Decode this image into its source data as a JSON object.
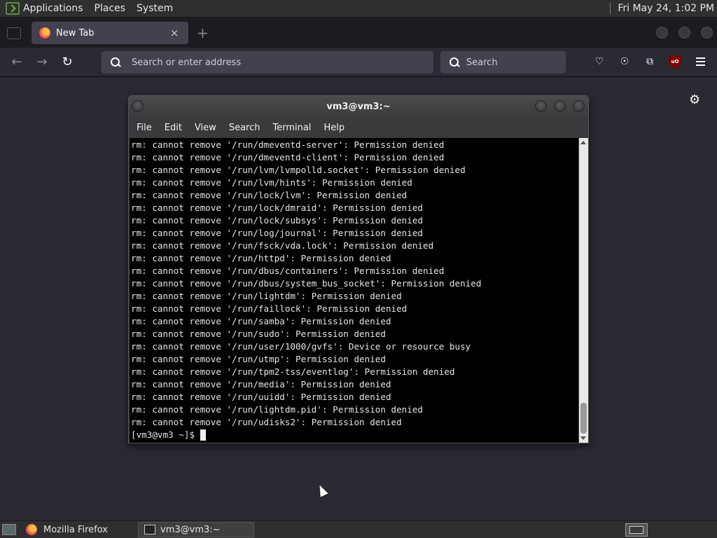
{
  "top_panel": {
    "menus": [
      "Applications",
      "Places",
      "System"
    ],
    "clock": "Fri May 24,  1:02 PM"
  },
  "firefox": {
    "tab": {
      "title": "New Tab",
      "close": "×"
    },
    "urlbar": {
      "placeholder": "Search or enter address"
    },
    "searchbar": {
      "placeholder": "Search"
    },
    "ublock_label": "uO"
  },
  "terminal": {
    "title": "vm3@vm3:~",
    "menus": [
      "File",
      "Edit",
      "View",
      "Search",
      "Terminal",
      "Help"
    ],
    "lines": [
      "rm: cannot remove '/run/dmeventd-server': Permission denied",
      "rm: cannot remove '/run/dmeventd-client': Permission denied",
      "rm: cannot remove '/run/lvm/lvmpolld.socket': Permission denied",
      "rm: cannot remove '/run/lvm/hints': Permission denied",
      "rm: cannot remove '/run/lock/lvm': Permission denied",
      "rm: cannot remove '/run/lock/dmraid': Permission denied",
      "rm: cannot remove '/run/lock/subsys': Permission denied",
      "rm: cannot remove '/run/log/journal': Permission denied",
      "rm: cannot remove '/run/fsck/vda.lock': Permission denied",
      "rm: cannot remove '/run/httpd': Permission denied",
      "rm: cannot remove '/run/dbus/containers': Permission denied",
      "rm: cannot remove '/run/dbus/system_bus_socket': Permission denied",
      "rm: cannot remove '/run/lightdm': Permission denied",
      "rm: cannot remove '/run/faillock': Permission denied",
      "rm: cannot remove '/run/samba': Permission denied",
      "rm: cannot remove '/run/sudo': Permission denied",
      "rm: cannot remove '/run/user/1000/gvfs': Device or resource busy",
      "rm: cannot remove '/run/utmp': Permission denied",
      "rm: cannot remove '/run/tpm2-tss/eventlog': Permission denied",
      "rm: cannot remove '/run/media': Permission denied",
      "rm: cannot remove '/run/uuidd': Permission denied",
      "rm: cannot remove '/run/lightdm.pid': Permission denied",
      "rm: cannot remove '/run/udisks2': Permission denied"
    ],
    "prompt": "[vm3@vm3 ~]$"
  },
  "taskbar": {
    "tasks": [
      {
        "label": "Mozilla Firefox",
        "icon": "firefox-icon",
        "active": false
      },
      {
        "label": "vm3@vm3:~",
        "icon": "terminal-icon",
        "active": true
      }
    ]
  }
}
